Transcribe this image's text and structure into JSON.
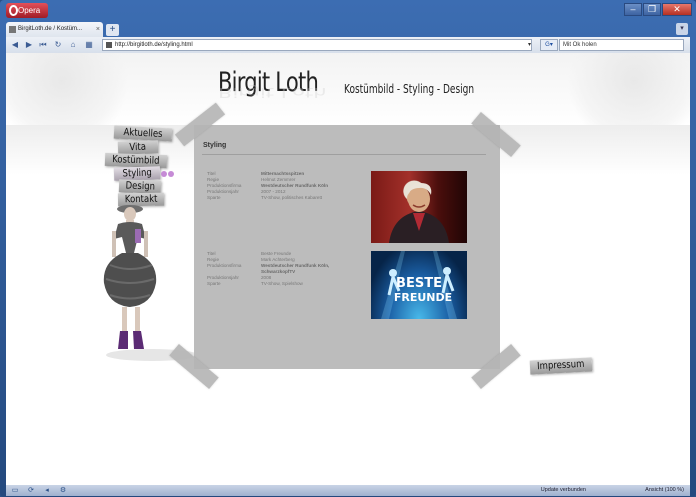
{
  "browser": {
    "menu_button": "Opera",
    "window_controls": [
      "–",
      "❐",
      "✕"
    ],
    "tab_title": "BirgitLoth.de / Kostüm...",
    "tab_close": "×",
    "new_tab": "+",
    "url": "http://birgitloth.de/styling.html",
    "search_placeholder": "Mit Ok holen",
    "status_update": "Update verbunden",
    "zoom": "Ansicht (100 %)"
  },
  "site": {
    "title": "Birgit Loth",
    "subtitle": "Kostümbild - Styling - Design",
    "nav": [
      "Aktuelles",
      "Vita",
      "Kostümbild",
      "Styling",
      "Design",
      "Kontakt"
    ],
    "active_nav": "Styling",
    "footer_link": "Impressum"
  },
  "panel": {
    "title": "Styling",
    "entries": [
      {
        "rows": [
          {
            "k": "Titel",
            "v": "Mitternachtsspitzen",
            "bold": true
          },
          {
            "k": "Regie",
            "v": "Helmut Zemmrer",
            "bold": false
          },
          {
            "k": "Produktionsfirma",
            "v": "Westdeutscher Rundfunk Köln",
            "bold": true
          },
          {
            "k": "Produktionsjahr",
            "v": "2007 - 2012",
            "bold": false
          },
          {
            "k": "Sparte",
            "v": "TV-Show, politisches Kabarett",
            "bold": false
          }
        ]
      },
      {
        "rows": [
          {
            "k": "Titel",
            "v": "Beste Freunde",
            "bold": false
          },
          {
            "k": "Regie",
            "v": "Mark Achterberg",
            "bold": false
          },
          {
            "k": "Produktionsfirma",
            "v": "Westdeutscher Rundfunk Köln,",
            "bold": true
          },
          {
            "k": "",
            "v": "SchwarzkopfTV",
            "bold": true
          },
          {
            "k": "Produktionsjahr",
            "v": "2008",
            "bold": false
          },
          {
            "k": "Sparte",
            "v": "TV-Show, Spielshow",
            "bold": false
          }
        ],
        "photo_text": [
          "BESTE",
          "FREUNDE"
        ]
      }
    ]
  },
  "colors": {
    "panel": "#bcbcbc",
    "accent_purple": "#c68bd6",
    "browser_blue": "#2a4f86"
  }
}
